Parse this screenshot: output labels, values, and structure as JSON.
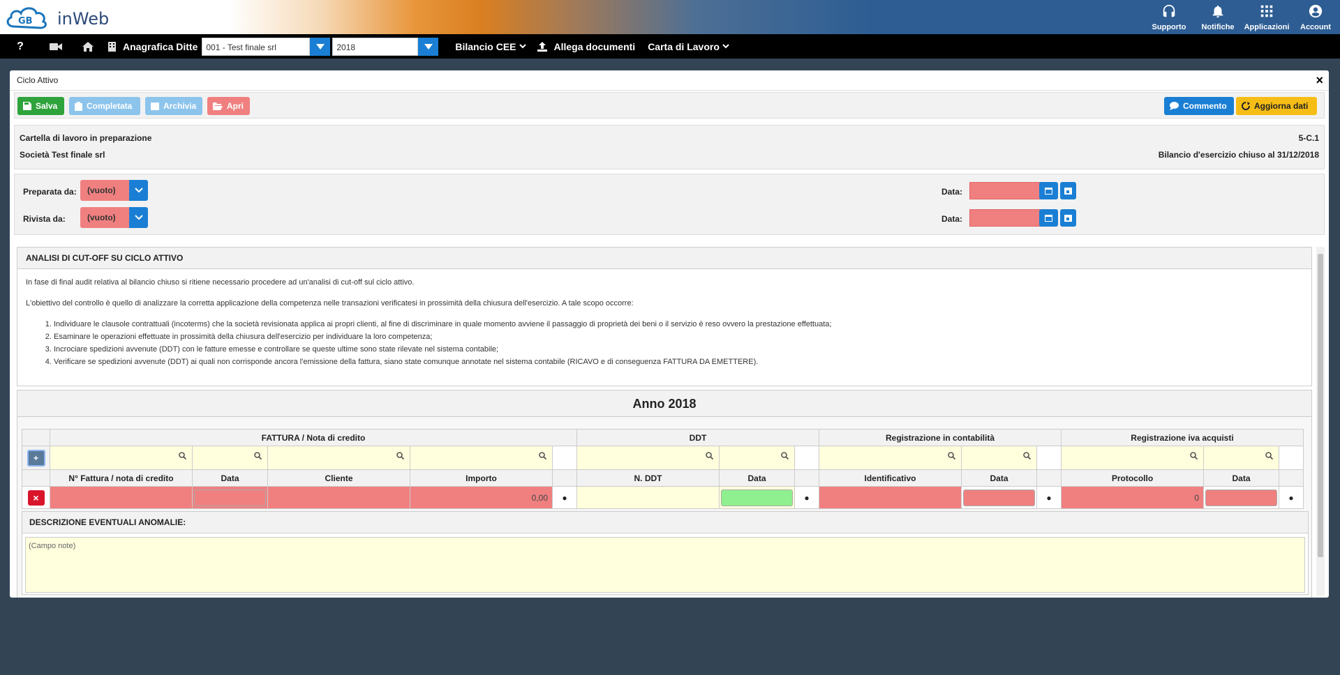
{
  "brand": {
    "name": "inWeb"
  },
  "top_icons": [
    {
      "label": "Supporto",
      "icon": "headset-icon"
    },
    {
      "label": "Notifiche",
      "icon": "bell-icon"
    },
    {
      "label": "Applicazioni",
      "icon": "grid-icon"
    },
    {
      "label": "Account",
      "icon": "account-icon"
    }
  ],
  "nav": {
    "help": "?",
    "company_label": "Anagrafica Ditte",
    "company_value": "001 - Test finale srl",
    "year_value": "2018",
    "menu1": "Bilancio CEE",
    "menu2": "Allega documenti",
    "menu3": "Carta di Lavoro"
  },
  "panel": {
    "title": "Ciclo Attivo",
    "close": "×"
  },
  "toolbar": {
    "save": "Salva",
    "completed": "Completata",
    "archive": "Archivia",
    "open": "Apri",
    "comment": "Commento",
    "refresh": "Aggiorna dati"
  },
  "info": {
    "status": "Cartella di lavoro in preparazione",
    "company": "Società Test finale srl",
    "code": "5-C.1",
    "period": "Bilancio d'esercizio chiuso al 31/12/2018"
  },
  "prep": {
    "prepared_label": "Preparata da:",
    "prepared_value": "(vuoto)",
    "reviewed_label": "Rivista da:",
    "reviewed_value": "(vuoto)",
    "date_label": "Data:"
  },
  "analysis": {
    "title": "ANALISI DI CUT-OFF SU CICLO ATTIVO",
    "p1": "In fase di final audit relativa al bilancio chiuso si ritiene necessario procedere ad un'analisi di cut-off sul ciclo attivo.",
    "p2": "L'obiettivo del controllo è quello di analizzare la corretta applicazione della competenza nelle transazioni verificatesi in prossimità della chiusura dell'esercizio. A tale scopo occorre:",
    "items": [
      "Individuare le clausole contrattuali (incoterms) che la società revisionata applica ai propri clienti, al fine di discriminare in quale momento avviene il passaggio di proprietà dei beni o il servizio è reso ovvero la prestazione effettuata;",
      "Esaminare le operazioni effettuate in prossimità della chiusura dell'esercizio per individuare la loro competenza;",
      "Incrociare spedizioni avvenute (DDT) con le fatture emesse e controllare se queste ultime sono state rilevate nel sistema contabile;",
      "Verificare se spedizioni avvenute (DDT) ai quali non corrisponde ancora l'emissione della fattura, siano state comunque annotate nel sistema contabile (RICAVO e di conseguenza FATTURA DA EMETTERE)."
    ]
  },
  "grid": {
    "year_title": "Anno 2018",
    "groups": [
      "FATTURA / Nota di credito",
      "DDT",
      "Registrazione in contabilità",
      "Registrazione iva acquisti"
    ],
    "columns": [
      "N° Fattura / nota di credito",
      "Data",
      "Cliente",
      "Importo",
      "N. DDT",
      "Data",
      "Identificativo",
      "Data",
      "Protocollo",
      "Data"
    ],
    "add": "+",
    "delete": "×",
    "row": {
      "importo": "0,00",
      "protocollo": "0"
    }
  },
  "anomalie": {
    "title": "DESCRIZIONE EVENTUALI ANOMALIE:",
    "placeholder": "(Campo note)"
  }
}
